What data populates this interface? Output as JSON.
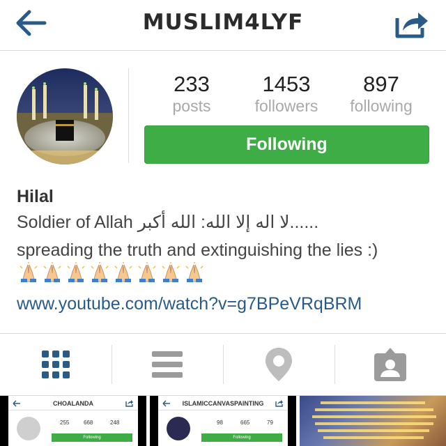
{
  "header": {
    "title": "MUSLIM4LYF",
    "back_icon": "back-arrow-icon",
    "share_icon": "share-icon",
    "accent": "#2a5b88"
  },
  "profile": {
    "stats": [
      {
        "value": "233",
        "label": "posts"
      },
      {
        "value": "1453",
        "label": "followers"
      },
      {
        "value": "897",
        "label": "following"
      }
    ],
    "follow_button": "Following",
    "follow_color": "#3fad46",
    "name": "Hilal",
    "bio_line1": "Soldier of Allah لا اله إلا الله: الله أكبر......",
    "bio_line2": "spreading the truth and extinguishing the lies :)",
    "bio_emoji": "praying-hands-icon",
    "bio_emoji_count": 8,
    "link": "www.youtube.com/watch?v=g7BPeVRqBRM"
  },
  "tabs": [
    {
      "name": "grid-view",
      "icon": "grid-icon",
      "active": true
    },
    {
      "name": "list-view",
      "icon": "list-icon",
      "active": false
    },
    {
      "name": "map-view",
      "icon": "location-pin-icon",
      "active": false
    },
    {
      "name": "tagged-view",
      "icon": "tagged-person-icon",
      "active": false
    }
  ],
  "posts": [
    {
      "title": "CHOALANDA",
      "stats": [
        "255",
        "668",
        "248"
      ],
      "button": "Following"
    },
    {
      "title": "ISLAMICCANVASPAINTING",
      "stats": [
        "98",
        "665",
        "79"
      ],
      "button": "Following"
    },
    {
      "title": "",
      "stats": [],
      "button": ""
    }
  ]
}
